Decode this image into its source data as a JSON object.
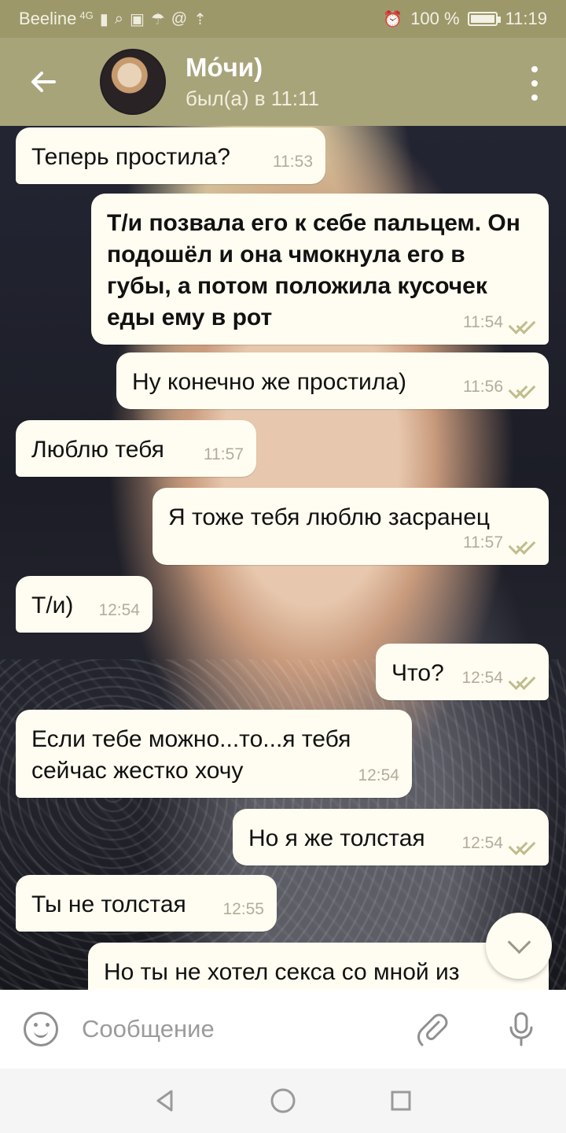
{
  "status_bar": {
    "carrier": "Beeline",
    "network": "4G",
    "battery": "100 %",
    "time": "11:19",
    "icons": [
      "signal-icon",
      "search-icon",
      "image-icon",
      "umbrella-icon",
      "at-icon",
      "upload-icon",
      "alarm-icon",
      "battery-icon"
    ]
  },
  "header": {
    "title": "Мо́чи)",
    "status": "был(а) в 11:11"
  },
  "messages": [
    {
      "text": "Теперь простила?",
      "time": "11:53",
      "direction": "in"
    },
    {
      "text": "Т/и позвала его к себе пальцем. Он подошёл и она чмокнула его в губы, а потом положила кусочек еды ему в рот",
      "time": "11:54",
      "direction": "out",
      "read": true
    },
    {
      "text": "Ну конечно же простила)",
      "time": "11:56",
      "direction": "out",
      "read": true
    },
    {
      "text": "Люблю тебя",
      "time": "11:57",
      "direction": "in"
    },
    {
      "text": "Я тоже тебя люблю засранец",
      "time": "11:57",
      "direction": "out",
      "read": true
    },
    {
      "text": "Т/и)",
      "time": "12:54",
      "direction": "in"
    },
    {
      "text": "Что?",
      "time": "12:54",
      "direction": "out",
      "read": true
    },
    {
      "text": "Если тебе можно...то...я тебя сейчас жестко хочу",
      "time": "12:54",
      "direction": "in"
    },
    {
      "text": "Но я же толстая",
      "time": "12:54",
      "direction": "out",
      "read": true
    },
    {
      "text": "Ты не толстая",
      "time": "12:55",
      "direction": "in"
    },
    {
      "text": "Но ты не хотел секса со мной из",
      "time": "",
      "direction": "out"
    }
  ],
  "composer": {
    "placeholder": "Сообщение"
  },
  "colors": {
    "header": "#a8a47a",
    "status_bar": "#9c9869",
    "bubble": "#fffdf1",
    "read_tick": "#c0bc8d"
  }
}
